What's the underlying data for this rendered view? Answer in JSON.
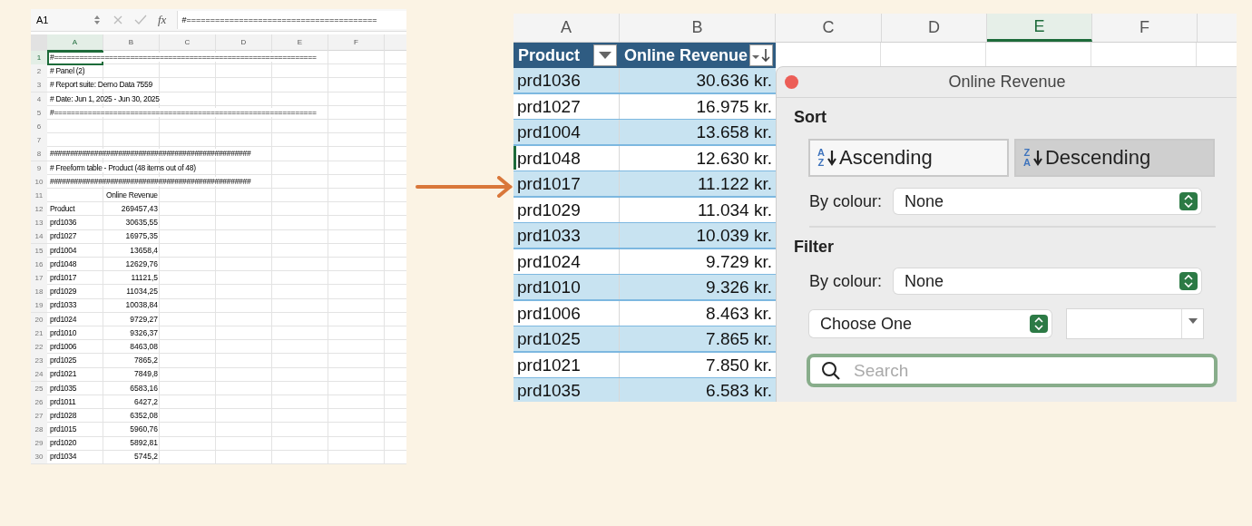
{
  "left_sheet": {
    "name_box": "A1",
    "fx": "fx",
    "formula": "#========================================",
    "columns": [
      {
        "label": "A",
        "selected": true
      },
      {
        "label": "B",
        "selected": false
      },
      {
        "label": "C",
        "selected": false
      },
      {
        "label": "D",
        "selected": false
      },
      {
        "label": "E",
        "selected": false
      },
      {
        "label": "F",
        "selected": false
      }
    ],
    "rows": [
      {
        "number": "1",
        "selected": true,
        "a": "#=============================================================="
      },
      {
        "number": "2",
        "selected": false,
        "a": "# Panel (2)"
      },
      {
        "number": "3",
        "selected": false,
        "a": "# Report suite: Demo Data 7559"
      },
      {
        "number": "4",
        "selected": false,
        "a": "# Date: Jun 1, 2025 - Jun 30, 2025"
      },
      {
        "number": "5",
        "selected": false,
        "a": "#=============================================================="
      },
      {
        "number": "6",
        "selected": false
      },
      {
        "number": "7",
        "selected": false
      },
      {
        "number": "8",
        "selected": false,
        "a": "##################################################"
      },
      {
        "number": "9",
        "selected": false,
        "a": "# Freeform table - Product (48 items out of 48)"
      },
      {
        "number": "10",
        "selected": false,
        "a": "##################################################"
      },
      {
        "number": "11",
        "selected": false,
        "b_label": "Online Revenue"
      },
      {
        "number": "12",
        "selected": false,
        "a": "Product",
        "b": "269457,43"
      },
      {
        "number": "13",
        "selected": false,
        "a": "prd1036",
        "b": "30635,55"
      },
      {
        "number": "14",
        "selected": false,
        "a": "prd1027",
        "b": "16975,35"
      },
      {
        "number": "15",
        "selected": false,
        "a": "prd1004",
        "b": "13658,4"
      },
      {
        "number": "16",
        "selected": false,
        "a": "prd1048",
        "b": "12629,76"
      },
      {
        "number": "17",
        "selected": false,
        "a": "prd1017",
        "b": "11121,5"
      },
      {
        "number": "18",
        "selected": false,
        "a": "prd1029",
        "b": "11034,25"
      },
      {
        "number": "19",
        "selected": false,
        "a": "prd1033",
        "b": "10038,84"
      },
      {
        "number": "20",
        "selected": false,
        "a": "prd1024",
        "b": "9729,27"
      },
      {
        "number": "21",
        "selected": false,
        "a": "prd1010",
        "b": "9326,37"
      },
      {
        "number": "22",
        "selected": false,
        "a": "prd1006",
        "b": "8463,08"
      },
      {
        "number": "23",
        "selected": false,
        "a": "prd1025",
        "b": "7865,2"
      },
      {
        "number": "24",
        "selected": false,
        "a": "prd1021",
        "b": "7849,8"
      },
      {
        "number": "25",
        "selected": false,
        "a": "prd1035",
        "b": "6583,16"
      },
      {
        "number": "26",
        "selected": false,
        "a": "prd1011",
        "b": "6427,2"
      },
      {
        "number": "27",
        "selected": false,
        "a": "prd1028",
        "b": "6352,08"
      },
      {
        "number": "28",
        "selected": false,
        "a": "prd1015",
        "b": "5960,76"
      },
      {
        "number": "29",
        "selected": false,
        "a": "prd1020",
        "b": "5892,81"
      },
      {
        "number": "30",
        "selected": false,
        "a": "prd1034",
        "b": "5745,2"
      }
    ]
  },
  "right_sheet": {
    "columns": [
      {
        "label": "A",
        "selected": false
      },
      {
        "label": "B",
        "selected": false
      },
      {
        "label": "C",
        "selected": false
      },
      {
        "label": "D",
        "selected": false
      },
      {
        "label": "E",
        "selected": true
      },
      {
        "label": "F",
        "selected": false
      }
    ],
    "headers": [
      "Product",
      "Online Revenue"
    ],
    "rows": [
      {
        "product": "prd1036",
        "revenue": "30.636 kr.",
        "selected": false
      },
      {
        "product": "prd1027",
        "revenue": "16.975 kr.",
        "selected": false
      },
      {
        "product": "prd1004",
        "revenue": "13.658 kr.",
        "selected": false
      },
      {
        "product": "prd1048",
        "revenue": "12.630 kr.",
        "selected": true
      },
      {
        "product": "prd1017",
        "revenue": "11.122 kr.",
        "selected": false
      },
      {
        "product": "prd1029",
        "revenue": "11.034 kr.",
        "selected": false
      },
      {
        "product": "prd1033",
        "revenue": "10.039 kr.",
        "selected": false
      },
      {
        "product": "prd1024",
        "revenue": "9.729 kr.",
        "selected": false
      },
      {
        "product": "prd1010",
        "revenue": "9.326 kr.",
        "selected": false
      },
      {
        "product": "prd1006",
        "revenue": "8.463 kr.",
        "selected": false
      },
      {
        "product": "prd1025",
        "revenue": "7.865 kr.",
        "selected": false
      },
      {
        "product": "prd1021",
        "revenue": "7.850 kr.",
        "selected": false
      },
      {
        "product": "prd1035",
        "revenue": "6.583 kr.",
        "selected": false
      }
    ],
    "dialog": {
      "title": "Online Revenue",
      "sort_heading": "Sort",
      "sort_buttons": [
        {
          "label": "Ascending",
          "icon_top": "A",
          "icon_bottom": "Z",
          "selected": false
        },
        {
          "label": "Descending",
          "icon_top": "Z",
          "icon_bottom": "A",
          "selected": true
        }
      ],
      "sort_colour": {
        "label": "By colour:",
        "value": "None"
      },
      "filter_heading": "Filter",
      "filter_colour": {
        "label": "By colour:",
        "value": "None"
      },
      "condition": {
        "value": "Choose One"
      },
      "search": {
        "placeholder": "Search"
      }
    }
  }
}
